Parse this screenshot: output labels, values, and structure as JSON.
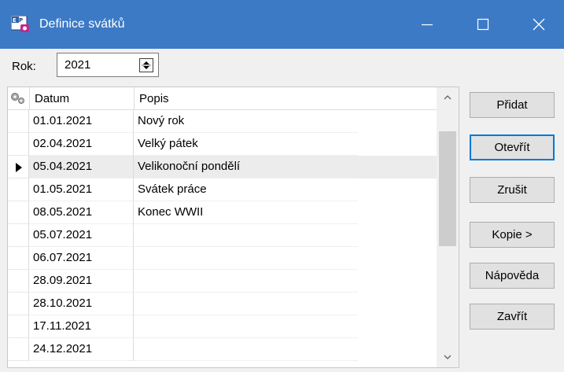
{
  "window": {
    "title": "Definice svátků",
    "app_icon_text": "EP",
    "controls": {
      "minimize": "minimize-icon",
      "maximize": "maximize-icon",
      "close": "close-icon"
    }
  },
  "year": {
    "label": "Rok:",
    "value": "2021"
  },
  "table": {
    "columns": [
      "Datum",
      "Popis"
    ],
    "selected_row": 2,
    "rows": [
      {
        "date": "01.01.2021",
        "desc": "Nový rok"
      },
      {
        "date": "02.04.2021",
        "desc": "Velký pátek"
      },
      {
        "date": "05.04.2021",
        "desc": "Velikonoční pondělí"
      },
      {
        "date": "01.05.2021",
        "desc": "Svátek práce"
      },
      {
        "date": "08.05.2021",
        "desc": "Konec WWII"
      },
      {
        "date": "05.07.2021",
        "desc": ""
      },
      {
        "date": "06.07.2021",
        "desc": ""
      },
      {
        "date": "28.09.2021",
        "desc": ""
      },
      {
        "date": "28.10.2021",
        "desc": ""
      },
      {
        "date": "17.11.2021",
        "desc": ""
      },
      {
        "date": "24.12.2021",
        "desc": ""
      }
    ]
  },
  "buttons": {
    "add": "Přidat",
    "open": "Otevřít",
    "delete": "Zrušit",
    "copy": "Kopie >",
    "help": "Nápověda",
    "close": "Zavřít"
  },
  "colors": {
    "titlebar": "#3c7ac6",
    "focus_border": "#0078d7"
  }
}
